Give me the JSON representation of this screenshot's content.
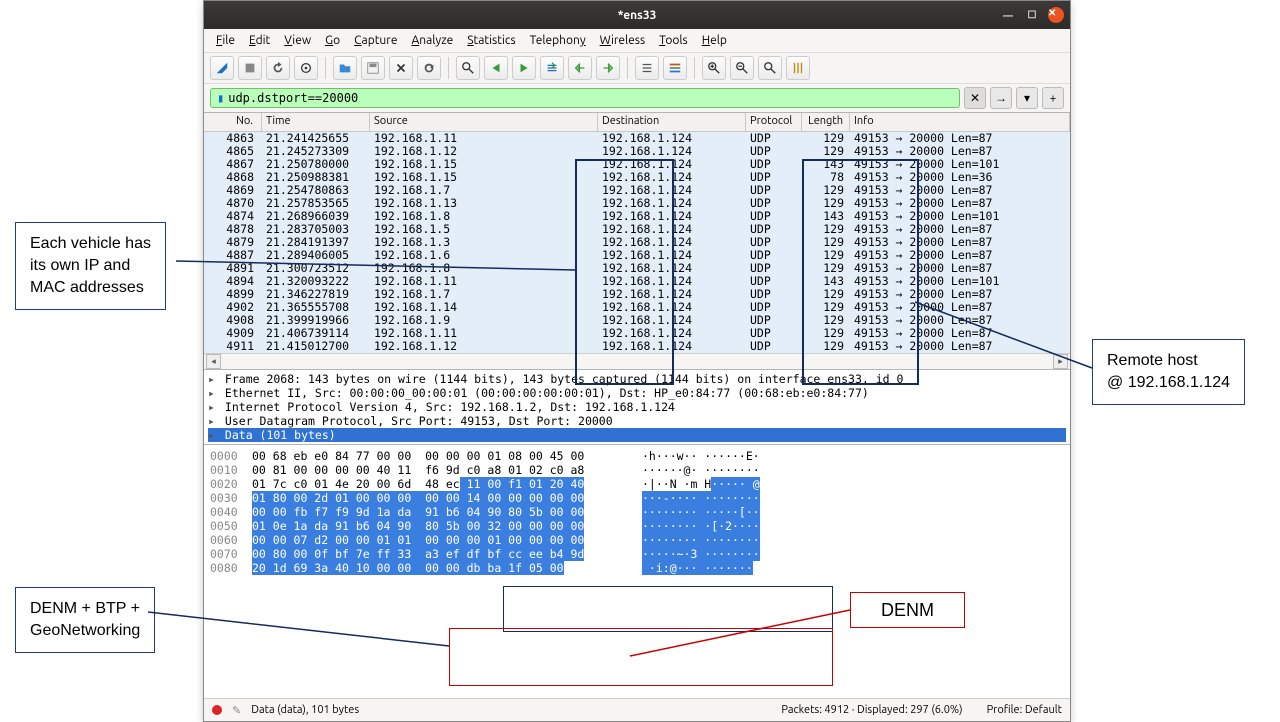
{
  "title": "*ens33",
  "menus": [
    "File",
    "Edit",
    "View",
    "Go",
    "Capture",
    "Analyze",
    "Statistics",
    "Telephony",
    "Wireless",
    "Tools",
    "Help"
  ],
  "filter_value": "udp.dstport==20000",
  "columns": {
    "no": "No.",
    "time": "Time",
    "src": "Source",
    "dst": "Destination",
    "proto": "Protocol",
    "len": "Length",
    "info": "Info"
  },
  "packets": [
    {
      "no": 4863,
      "time": "21.241425655",
      "src": "192.168.1.11",
      "dst": "192.168.1.124",
      "proto": "UDP",
      "len": 129,
      "info": "49153 → 20000 Len=87"
    },
    {
      "no": 4865,
      "time": "21.245273309",
      "src": "192.168.1.12",
      "dst": "192.168.1.124",
      "proto": "UDP",
      "len": 129,
      "info": "49153 → 20000 Len=87"
    },
    {
      "no": 4867,
      "time": "21.250780000",
      "src": "192.168.1.15",
      "dst": "192.168.1.124",
      "proto": "UDP",
      "len": 143,
      "info": "49153 → 20000 Len=101"
    },
    {
      "no": 4868,
      "time": "21.250988381",
      "src": "192.168.1.15",
      "dst": "192.168.1.124",
      "proto": "UDP",
      "len": 78,
      "info": "49153 → 20000 Len=36"
    },
    {
      "no": 4869,
      "time": "21.254780863",
      "src": "192.168.1.7",
      "dst": "192.168.1.124",
      "proto": "UDP",
      "len": 129,
      "info": "49153 → 20000 Len=87"
    },
    {
      "no": 4870,
      "time": "21.257853565",
      "src": "192.168.1.13",
      "dst": "192.168.1.124",
      "proto": "UDP",
      "len": 129,
      "info": "49153 → 20000 Len=87"
    },
    {
      "no": 4874,
      "time": "21.268966039",
      "src": "192.168.1.8",
      "dst": "192.168.1.124",
      "proto": "UDP",
      "len": 143,
      "info": "49153 → 20000 Len=101"
    },
    {
      "no": 4878,
      "time": "21.283705003",
      "src": "192.168.1.5",
      "dst": "192.168.1.124",
      "proto": "UDP",
      "len": 129,
      "info": "49153 → 20000 Len=87"
    },
    {
      "no": 4879,
      "time": "21.284191397",
      "src": "192.168.1.3",
      "dst": "192.168.1.124",
      "proto": "UDP",
      "len": 129,
      "info": "49153 → 20000 Len=87"
    },
    {
      "no": 4887,
      "time": "21.289406005",
      "src": "192.168.1.6",
      "dst": "192.168.1.124",
      "proto": "UDP",
      "len": 129,
      "info": "49153 → 20000 Len=87"
    },
    {
      "no": 4891,
      "time": "21.300723512",
      "src": "192.168.1.8",
      "dst": "192.168.1.124",
      "proto": "UDP",
      "len": 129,
      "info": "49153 → 20000 Len=87"
    },
    {
      "no": 4894,
      "time": "21.320093222",
      "src": "192.168.1.11",
      "dst": "192.168.1.124",
      "proto": "UDP",
      "len": 143,
      "info": "49153 → 20000 Len=101"
    },
    {
      "no": 4899,
      "time": "21.346227819",
      "src": "192.168.1.7",
      "dst": "192.168.1.124",
      "proto": "UDP",
      "len": 129,
      "info": "49153 → 20000 Len=87"
    },
    {
      "no": 4902,
      "time": "21.365555708",
      "src": "192.168.1.14",
      "dst": "192.168.1.124",
      "proto": "UDP",
      "len": 129,
      "info": "49153 → 20000 Len=87"
    },
    {
      "no": 4908,
      "time": "21.399919966",
      "src": "192.168.1.9",
      "dst": "192.168.1.124",
      "proto": "UDP",
      "len": 129,
      "info": "49153 → 20000 Len=87"
    },
    {
      "no": 4909,
      "time": "21.406739114",
      "src": "192.168.1.11",
      "dst": "192.168.1.124",
      "proto": "UDP",
      "len": 129,
      "info": "49153 → 20000 Len=87"
    },
    {
      "no": 4911,
      "time": "21.415012700",
      "src": "192.168.1.12",
      "dst": "192.168.1.124",
      "proto": "UDP",
      "len": 129,
      "info": "49153 → 20000 Len=87"
    }
  ],
  "details": [
    "Frame 2068: 143 bytes on wire (1144 bits), 143 bytes captured (1144 bits) on interface ens33, id 0",
    "Ethernet II, Src: 00:00:00_00:00:01 (00:00:00:00:00:01), Dst: HP_e0:84:77 (00:68:eb:e0:84:77)",
    "Internet Protocol Version 4, Src: 192.168.1.2, Dst: 192.168.1.124",
    "User Datagram Protocol, Src Port: 49153, Dst Port: 20000",
    "Data (101 bytes)"
  ],
  "hex": [
    {
      "off": "0000",
      "hex": "00 68 eb e0 84 77 00 00  00 00 00 01 08 00 45 00",
      "asc": "·h···w·· ······E·",
      "hl": [
        0,
        0,
        0,
        0
      ]
    },
    {
      "off": "0010",
      "hex": "00 81 00 00 00 00 40 11  f6 9d c0 a8 01 02 c0 a8",
      "asc": "······@· ········",
      "hl": [
        0,
        0,
        0,
        0
      ]
    },
    {
      "off": "0020",
      "hex": "01 7c c0 01 4e 20 00 6d  48 ec 11 00 f1 01 20 40",
      "asc": "·|··N ·m H····· @",
      "hl": [
        30,
        47,
        10,
        16
      ]
    },
    {
      "off": "0030",
      "hex": "01 80 00 2d 01 00 00 00  00 00 14 00 00 00 00 00",
      "asc": "···-···· ········",
      "hl": [
        0,
        47,
        0,
        16
      ]
    },
    {
      "off": "0040",
      "hex": "00 00 fb f7 f9 9d 1a da  91 b6 04 90 80 5b 00 00",
      "asc": "········ ·····[··",
      "hl": [
        0,
        47,
        0,
        16
      ]
    },
    {
      "off": "0050",
      "hex": "01 0e 1a da 91 b6 04 90  80 5b 00 32 00 00 00 00",
      "asc": "········ ·[·2····",
      "hl": [
        0,
        47,
        0,
        16
      ]
    },
    {
      "off": "0060",
      "hex": "00 00 07 d2 00 00 01 01  00 00 00 01 00 00 00 00",
      "asc": "········ ········",
      "hl": [
        0,
        47,
        0,
        16
      ]
    },
    {
      "off": "0070",
      "hex": "00 80 00 0f bf 7e ff 33  a3 ef df bf cc ee b4 9d",
      "asc": "·····~·3 ········",
      "hl": [
        0,
        47,
        0,
        16
      ]
    },
    {
      "off": "0080",
      "hex": "20 1d 69 3a 40 10 00 00  00 00 db ba 1f 05 00",
      "asc": " ·i:@··· ·······",
      "hl": [
        0,
        44,
        0,
        15
      ]
    }
  ],
  "status": {
    "left": "Data (data), 101 bytes",
    "center": "Packets: 4912 · Displayed: 297 (6.0%)",
    "right": "Profile: Default"
  },
  "annotations": {
    "vehicle": "Each vehicle has\nits own IP and\nMAC addresses",
    "remote": "Remote host\n@ 192.168.1.124",
    "geo": "DENM + BTP +\nGeoNetworking",
    "denm": "DENM"
  }
}
